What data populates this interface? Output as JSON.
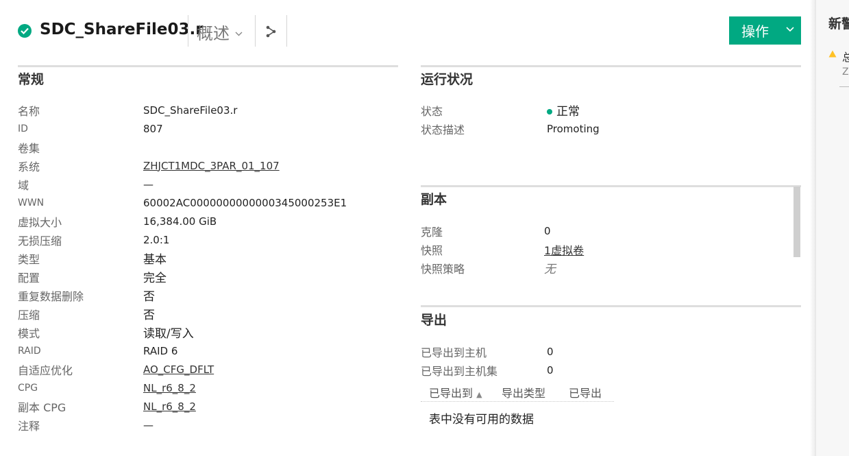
{
  "header": {
    "title": "SDC_ShareFile03.r",
    "view": "概述",
    "action_label": "操作"
  },
  "colors": {
    "accent": "#01a982",
    "warning": "#ffc125"
  },
  "general": {
    "title": "常规",
    "rows": [
      {
        "key": "名称",
        "value": "SDC_ShareFile03.r"
      },
      {
        "key": "ID",
        "value": "807"
      },
      {
        "key": "卷集",
        "value": ""
      },
      {
        "key": "系统",
        "value": "ZHJCT1MDC_3PAR_01_107"
      },
      {
        "key": "域",
        "value": "—"
      },
      {
        "key": "WWN",
        "value": "60002AC0000000000000345000253E1"
      },
      {
        "key": "虚拟大小",
        "value": "16,384.00 GiB"
      },
      {
        "key": "无损压缩",
        "value": "2.0:1"
      },
      {
        "key": "类型",
        "value": "基本"
      },
      {
        "key": "配置",
        "value": "完全"
      },
      {
        "key": "重复数据删除",
        "value": "否"
      },
      {
        "key": "压缩",
        "value": "否"
      },
      {
        "key": "模式",
        "value": "读取/写入"
      },
      {
        "key": "RAID",
        "value": "RAID 6"
      },
      {
        "key": "自适应优化",
        "value": "AO_CFG_DFLT"
      },
      {
        "key": "CPG",
        "value": "NL_r6_8_2"
      },
      {
        "key": "副本 CPG",
        "value": "NL_r6_8_2"
      },
      {
        "key": "注释",
        "value": "—"
      }
    ]
  },
  "health": {
    "title": "运行状况",
    "rows": [
      {
        "key": "状态",
        "value": "正常"
      },
      {
        "key": "状态描述",
        "value": "Promoting"
      }
    ]
  },
  "replica": {
    "title": "副本",
    "rows": [
      {
        "key": "克隆",
        "value": "0"
      },
      {
        "key": "快照",
        "value": "1虚拟卷"
      },
      {
        "key": "快照策略",
        "value": "无"
      }
    ]
  },
  "export": {
    "title": "导出",
    "rows": [
      {
        "key": "已导出到主机",
        "value": "0"
      },
      {
        "key": "已导出到主机集",
        "value": "0"
      }
    ],
    "columns": [
      "已导出到",
      "导出类型",
      "已导出"
    ],
    "sort_indicator": "▲",
    "empty_message": "表中没有可用的数据"
  },
  "right_panel": {
    "title": "新警",
    "item_label": "总",
    "item_sub": "Z"
  }
}
